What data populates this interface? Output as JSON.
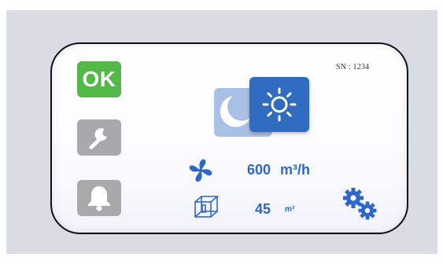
{
  "device": {
    "serial": "SN : 1234"
  },
  "sidebar": {
    "status_label": "OK",
    "status_color": "#52b848",
    "items": [
      {
        "icon": "wrench-icon"
      },
      {
        "icon": "bell-icon"
      }
    ],
    "inactive_color": "#a9a9ab"
  },
  "mode": {
    "options": [
      {
        "icon": "moon-icon",
        "color": "#a9c0e6",
        "active": false
      },
      {
        "icon": "sun-icon",
        "color": "#2f6bbf",
        "active": true
      }
    ]
  },
  "airflow": {
    "icon": "fan-icon",
    "value": "600",
    "unit": "m³/h"
  },
  "volume": {
    "icon": "cube-icon",
    "value": "45",
    "unit": "m³"
  },
  "settings": {
    "icon": "gears-icon"
  },
  "colors": {
    "accent": "#2f67c8",
    "background": "#d9dbe5"
  }
}
